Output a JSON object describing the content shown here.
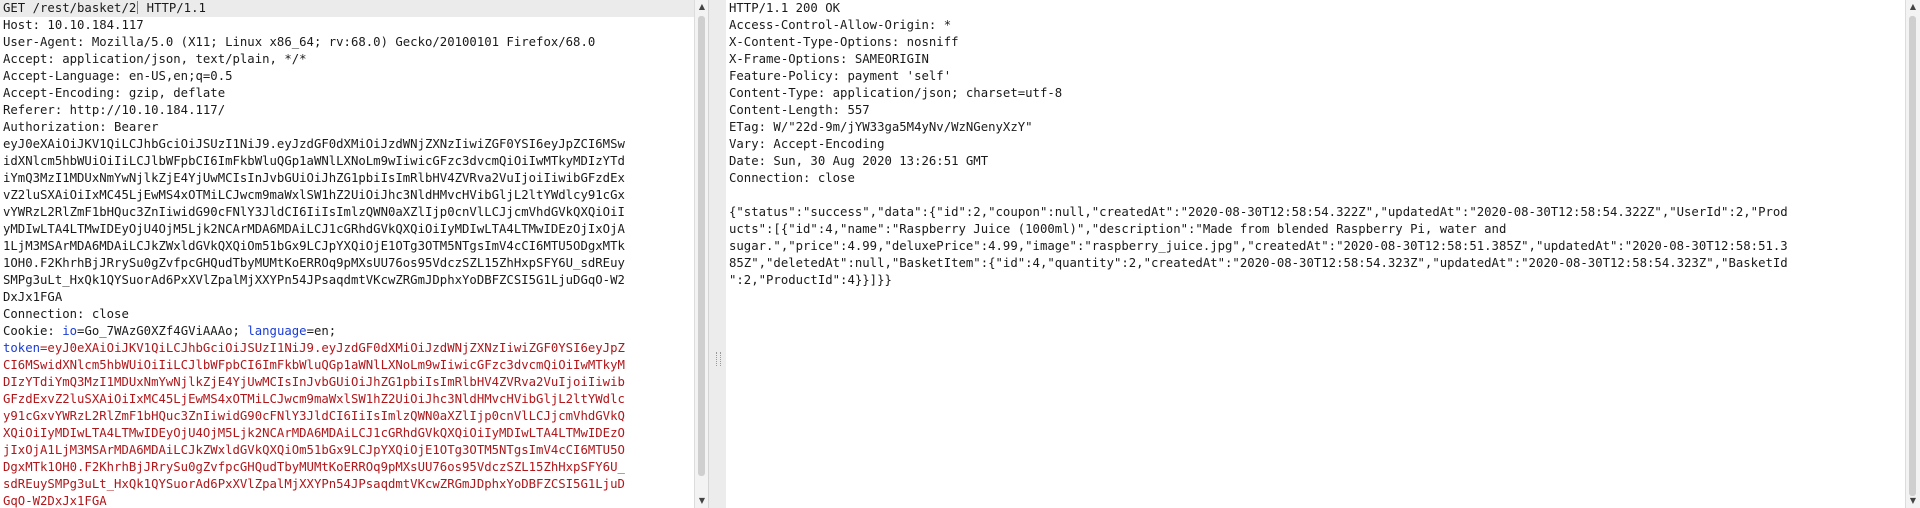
{
  "request": {
    "lines": [
      "GET /rest/basket/2",
      " HTTP/1.1",
      "Host: 10.10.184.117",
      "User-Agent: Mozilla/5.0 (X11; Linux x86_64; rv:68.0) Gecko/20100101 Firefox/68.0",
      "Accept: application/json, text/plain, */*",
      "Accept-Language: en-US,en;q=0.5",
      "Accept-Encoding: gzip, deflate",
      "Referer: http://10.10.184.117/",
      "Authorization: Bearer",
      "eyJ0eXAiOiJKV1QiLCJhbGciOiJSUzI1NiJ9.eyJzdGF0dXMiOiJzdWNjZXNzIiwiZGF0YSI6eyJpZCI6MSw",
      "idXNlcm5hbWUiOiIiLCJlbWFpbCI6ImFkbWluQGp1aWNlLXNoLm9wIiwicGFzc3dvcmQiOiIwMTkyMDIzYTd",
      "iYmQ3MzI1MDUxNmYwNjlkZjE4YjUwMCIsInJvbGUiOiJhZG1pbiIsImRlbHV4ZVRva2VuIjoiIiwibGFzdEx",
      "vZ2luSXAiOiIxMC45LjEwMS4xOTMiLCJwcm9maWxlSW1hZ2UiOiJhc3NldHMvcHVibGljL2ltYWdlcy91cGx",
      "vYWRzL2RlZmF1bHQuc3ZnIiwidG90cFNlY3JldCI6IiIsImlzQWN0aXZlIjp0cnVlLCJjcmVhdGVkQXQiOiI",
      "yMDIwLTA4LTMwIDEyOjU4OjM5Ljk2NCArMDA6MDAiLCJ1cGRhdGVkQXQiOiIyMDIwLTA4LTMwIDEzOjIxOjA",
      "1LjM3MSArMDA6MDAiLCJkZWxldGVkQXQiOm51bGx9LCJpYXQiOjE1OTg3OTM5NTgsImV4cCI6MTU5ODgxMTk",
      "1OH0.F2KhrhBjJRrySu0gZvfpcGHQudTbyMUMtKoERROq9pMXsUU76os95VdczSZL15ZhHxpSFY6U_sdREuy",
      "SMPg3uLt_HxQk1QYSuorAd6PxXVlZpalMjXXYPn54JPsaqdmtVKcwZRGmJDphxYoDBFZCSI5G1LjuDGqO-W2",
      "DxJx1FGA",
      "Connection: close"
    ],
    "cookie_prefix": "Cookie: ",
    "cookie_io_name": "io",
    "cookie_io_value": "=Go_7WAzG0XZf4GViAAAo; ",
    "cookie_lang_name": "language",
    "cookie_lang_value": "=en;",
    "token_name": "token",
    "token_lines": [
      "=eyJ0eXAiOiJKV1QiLCJhbGciOiJSUzI1NiJ9.eyJzdGF0dXMiOiJzdWNjZXNzIiwiZGF0YSI6eyJpZ",
      "CI6MSwidXNlcm5hbWUiOiIiLCJlbWFpbCI6ImFkbWluQGp1aWNlLXNoLm9wIiwicGFzc3dvcmQiOiIwMTkyM",
      "DIzYTdiYmQ3MzI1MDUxNmYwNjlkZjE4YjUwMCIsInJvbGUiOiJhZG1pbiIsImRlbHV4ZVRva2VuIjoiIiwib",
      "GFzdExvZ2luSXAiOiIxMC45LjEwMS4xOTMiLCJwcm9maWxlSW1hZ2UiOiJhc3NldHMvcHVibGljL2ltYWdlc",
      "y91cGxvYWRzL2RlZmF1bHQuc3ZnIiwidG90cFNlY3JldCI6IiIsImlzQWN0aXZlIjp0cnVlLCJjcmVhdGVkQ",
      "XQiOiIyMDIwLTA4LTMwIDEyOjU4OjM5Ljk2NCArMDA6MDAiLCJ1cGRhdGVkQXQiOiIyMDIwLTA4LTMwIDEzO",
      "jIxOjA1LjM3MSArMDA6MDAiLCJkZWxldGVkQXQiOm51bGx9LCJpYXQiOjE1OTg3OTM5NTgsImV4cCI6MTU5O",
      "DgxMTk1OH0.F2KhrhBjJRrySu0gZvfpcGHQudTbyMUMtKoERROq9pMXsUU76os95VdczSZL15ZhHxpSFY6U_",
      "sdREuySMPg3uLt_HxQk1QYSuorAd6PxXVlZpalMjXXYPn54JPsaqdmtVKcwZRGmJDphxYoDBFZCSI5G1LjuD",
      "GqO-W2DxJx1FGA"
    ]
  },
  "response": {
    "lines": [
      "HTTP/1.1 200 OK",
      "Access-Control-Allow-Origin: *",
      "X-Content-Type-Options: nosniff",
      "X-Frame-Options: SAMEORIGIN",
      "Feature-Policy: payment 'self'",
      "Content-Type: application/json; charset=utf-8",
      "Content-Length: 557",
      "ETag: W/\"22d-9m/jYW33ga5M4yNv/WzNGenyXzY\"",
      "Vary: Accept-Encoding",
      "Date: Sun, 30 Aug 2020 13:26:51 GMT",
      "Connection: close",
      "",
      "{\"status\":\"success\",\"data\":{\"id\":2,\"coupon\":null,\"createdAt\":\"2020-08-30T12:58:54.322Z\",\"updatedAt\":\"2020-08-30T12:58:54.322Z\",\"UserId\":2,\"Prod",
      "ucts\":[{\"id\":4,\"name\":\"Raspberry Juice (1000ml)\",\"description\":\"Made from blended Raspberry Pi, water and",
      "sugar.\",\"price\":4.99,\"deluxePrice\":4.99,\"image\":\"raspberry_juice.jpg\",\"createdAt\":\"2020-08-30T12:58:51.385Z\",\"updatedAt\":\"2020-08-30T12:58:51.3",
      "85Z\",\"deletedAt\":null,\"BasketItem\":{\"id\":4,\"quantity\":2,\"createdAt\":\"2020-08-30T12:58:54.323Z\",\"updatedAt\":\"2020-08-30T12:58:54.323Z\",\"BasketId",
      "\":2,\"ProductId\":4}}]}}"
    ]
  },
  "icons": {
    "scroll_up": "▲",
    "scroll_down": "▼"
  }
}
